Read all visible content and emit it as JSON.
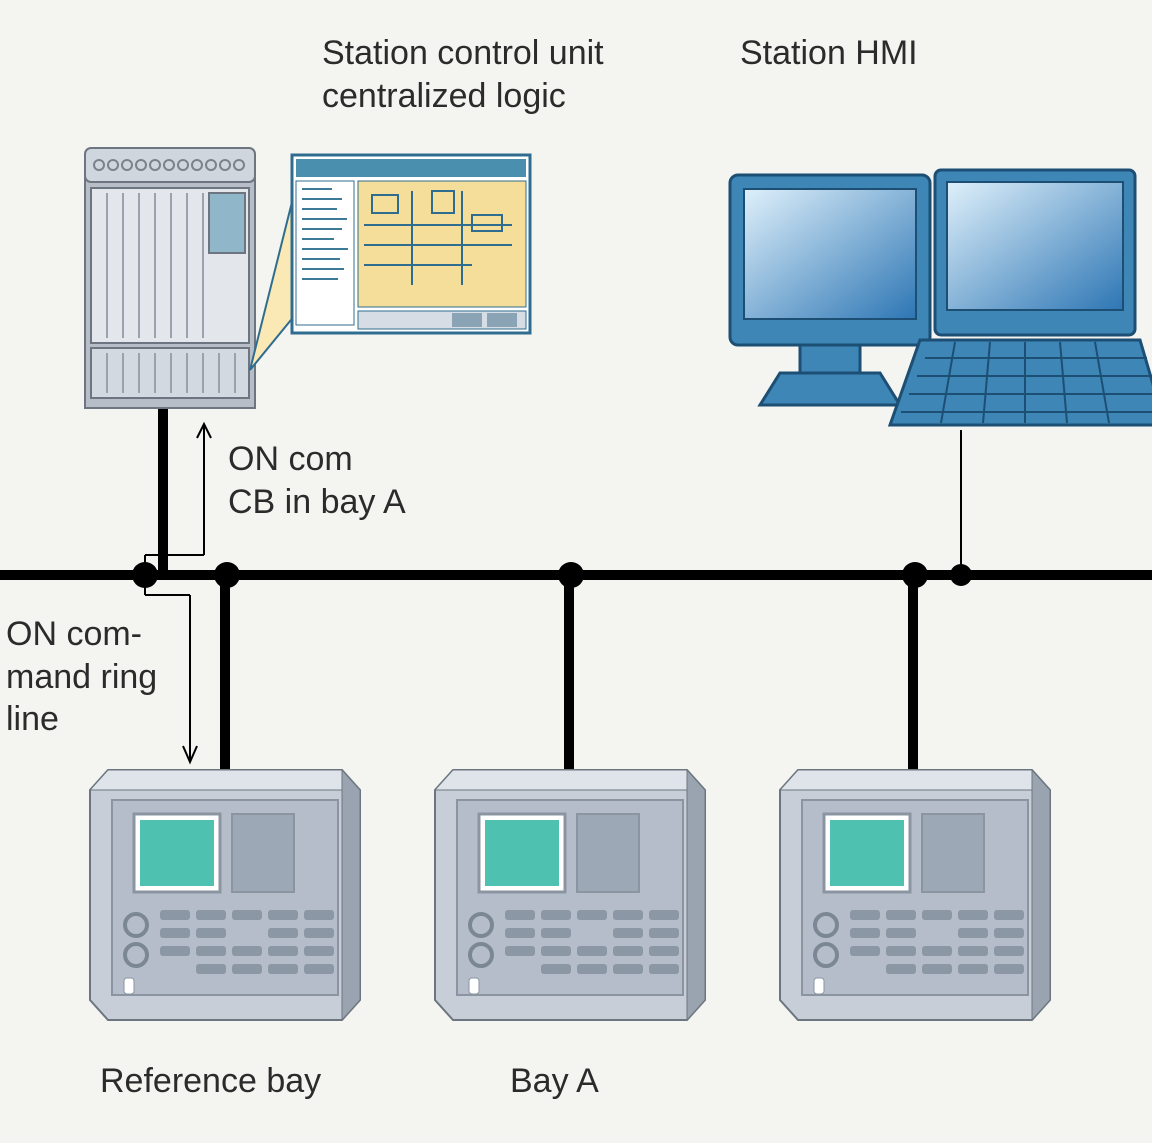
{
  "labels": {
    "station_control_unit_l1": "Station control unit",
    "station_control_unit_l2": "centralized logic",
    "station_hmi": "Station HMI",
    "on_com_l1": "ON com",
    "on_com_l2": "CB in bay A",
    "on_command_l1": "ON com-",
    "on_command_l2": "mand ring",
    "on_command_l3": "line",
    "reference_bay": "Reference bay",
    "bay_a": "Bay A"
  },
  "nodes": {
    "station_control_unit": "station-control-unit",
    "station_hmi": "station-hmi-workstations",
    "bus": "communication-bus",
    "reference_bay_device": "reference-bay-ied",
    "bay_a_device": "bay-a-ied",
    "third_bay_device": "third-bay-ied"
  }
}
